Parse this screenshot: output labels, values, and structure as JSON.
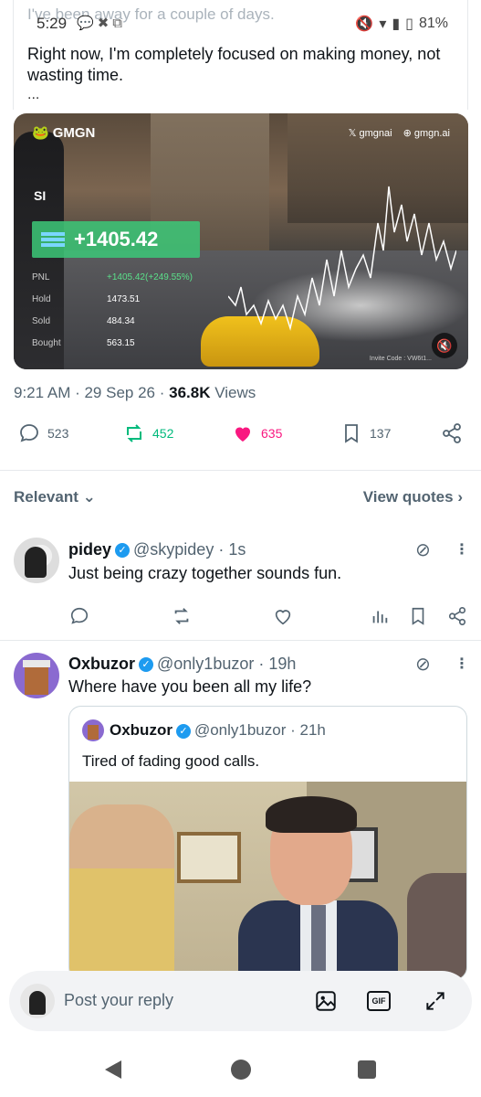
{
  "status_bar": {
    "faded_text": "I've been away for a couple of days.",
    "time": "5:29",
    "battery": "81%"
  },
  "tweet": {
    "text": "Right now, I'm completely focused on making money, not wasting time.",
    "ellipsis": "...",
    "media": {
      "brand": "GMGN",
      "brand_right_1": "gmgnai",
      "brand_right_2": "gmgn.ai",
      "user": "SI",
      "pnl_value": "+1405.42",
      "stats": [
        {
          "label": "PNL",
          "value": "+1405.42(+249.55%)"
        },
        {
          "label": "Hold",
          "value": "1473.51"
        },
        {
          "label": "Sold",
          "value": "484.34"
        },
        {
          "label": "Bought",
          "value": "563.15"
        }
      ],
      "invite": "Invite Code : VW6t1..."
    },
    "meta": {
      "time_date": "9:21 AM · 29 Sep 26 · ",
      "views_count": "36.8K",
      "views_label": " Views"
    },
    "actions": {
      "replies": "523",
      "reposts": "452",
      "likes": "635",
      "bookmarks": "137"
    }
  },
  "sort": {
    "label": "Relevant",
    "view_quotes": "View quotes"
  },
  "replies": [
    {
      "name": "pidey",
      "handle": "@skypidey · 1s",
      "text": "Just being crazy together sounds fun."
    },
    {
      "name": "Oxbuzor",
      "handle": "@only1buzor · 19h",
      "text": "Where have you been all my life?",
      "quote": {
        "name": "Oxbuzor",
        "handle": "@only1buzor · 21h",
        "text": "Tired of fading good calls."
      }
    }
  ],
  "reply_bar": {
    "placeholder": "Post your reply",
    "gif": "GIF"
  },
  "colors": {
    "like": "#f91880",
    "repost": "#00ba7c",
    "verified": "#1d9bf0",
    "muted": "#536471"
  }
}
